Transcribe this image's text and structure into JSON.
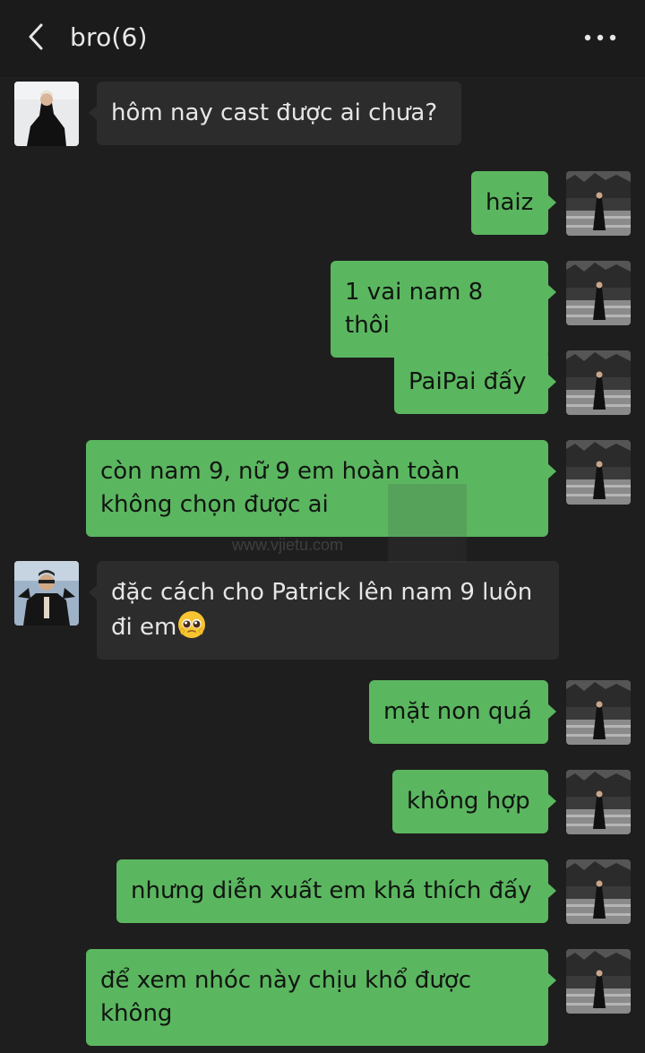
{
  "header": {
    "title": "bro(6)"
  },
  "watermark": {
    "text": "www.vjietu.com"
  },
  "messages": [
    {
      "side": "left",
      "text": "hôm nay cast được ai chưa?"
    },
    {
      "side": "right",
      "text": "haiz"
    },
    {
      "side": "right",
      "text": "1 vai nam 8 thôi"
    },
    {
      "side": "right",
      "text": "PaiPai đấy"
    },
    {
      "side": "right",
      "text": "còn nam 9, nữ 9 em hoàn toàn\nkhông chọn được ai"
    },
    {
      "side": "left",
      "text": "đặc cách cho Patrick lên nam 9 luôn\nđi em",
      "emoji": "pleading-face-emoji"
    },
    {
      "side": "right",
      "text": "mặt non quá"
    },
    {
      "side": "right",
      "text": "không hợp"
    },
    {
      "side": "right",
      "text": "nhưng diễn xuất em khá thích đấy"
    },
    {
      "side": "right",
      "text": "để xem nhóc này chịu khổ được\nkhông"
    }
  ],
  "icons": {
    "back": "chevron-left-icon",
    "more": "more-dots-icon"
  },
  "colors": {
    "background": "#1e1e1e",
    "header": "#1b1b1b",
    "incoming_bubble": "#2c2c2c",
    "outgoing_bubble": "#5bb660"
  }
}
